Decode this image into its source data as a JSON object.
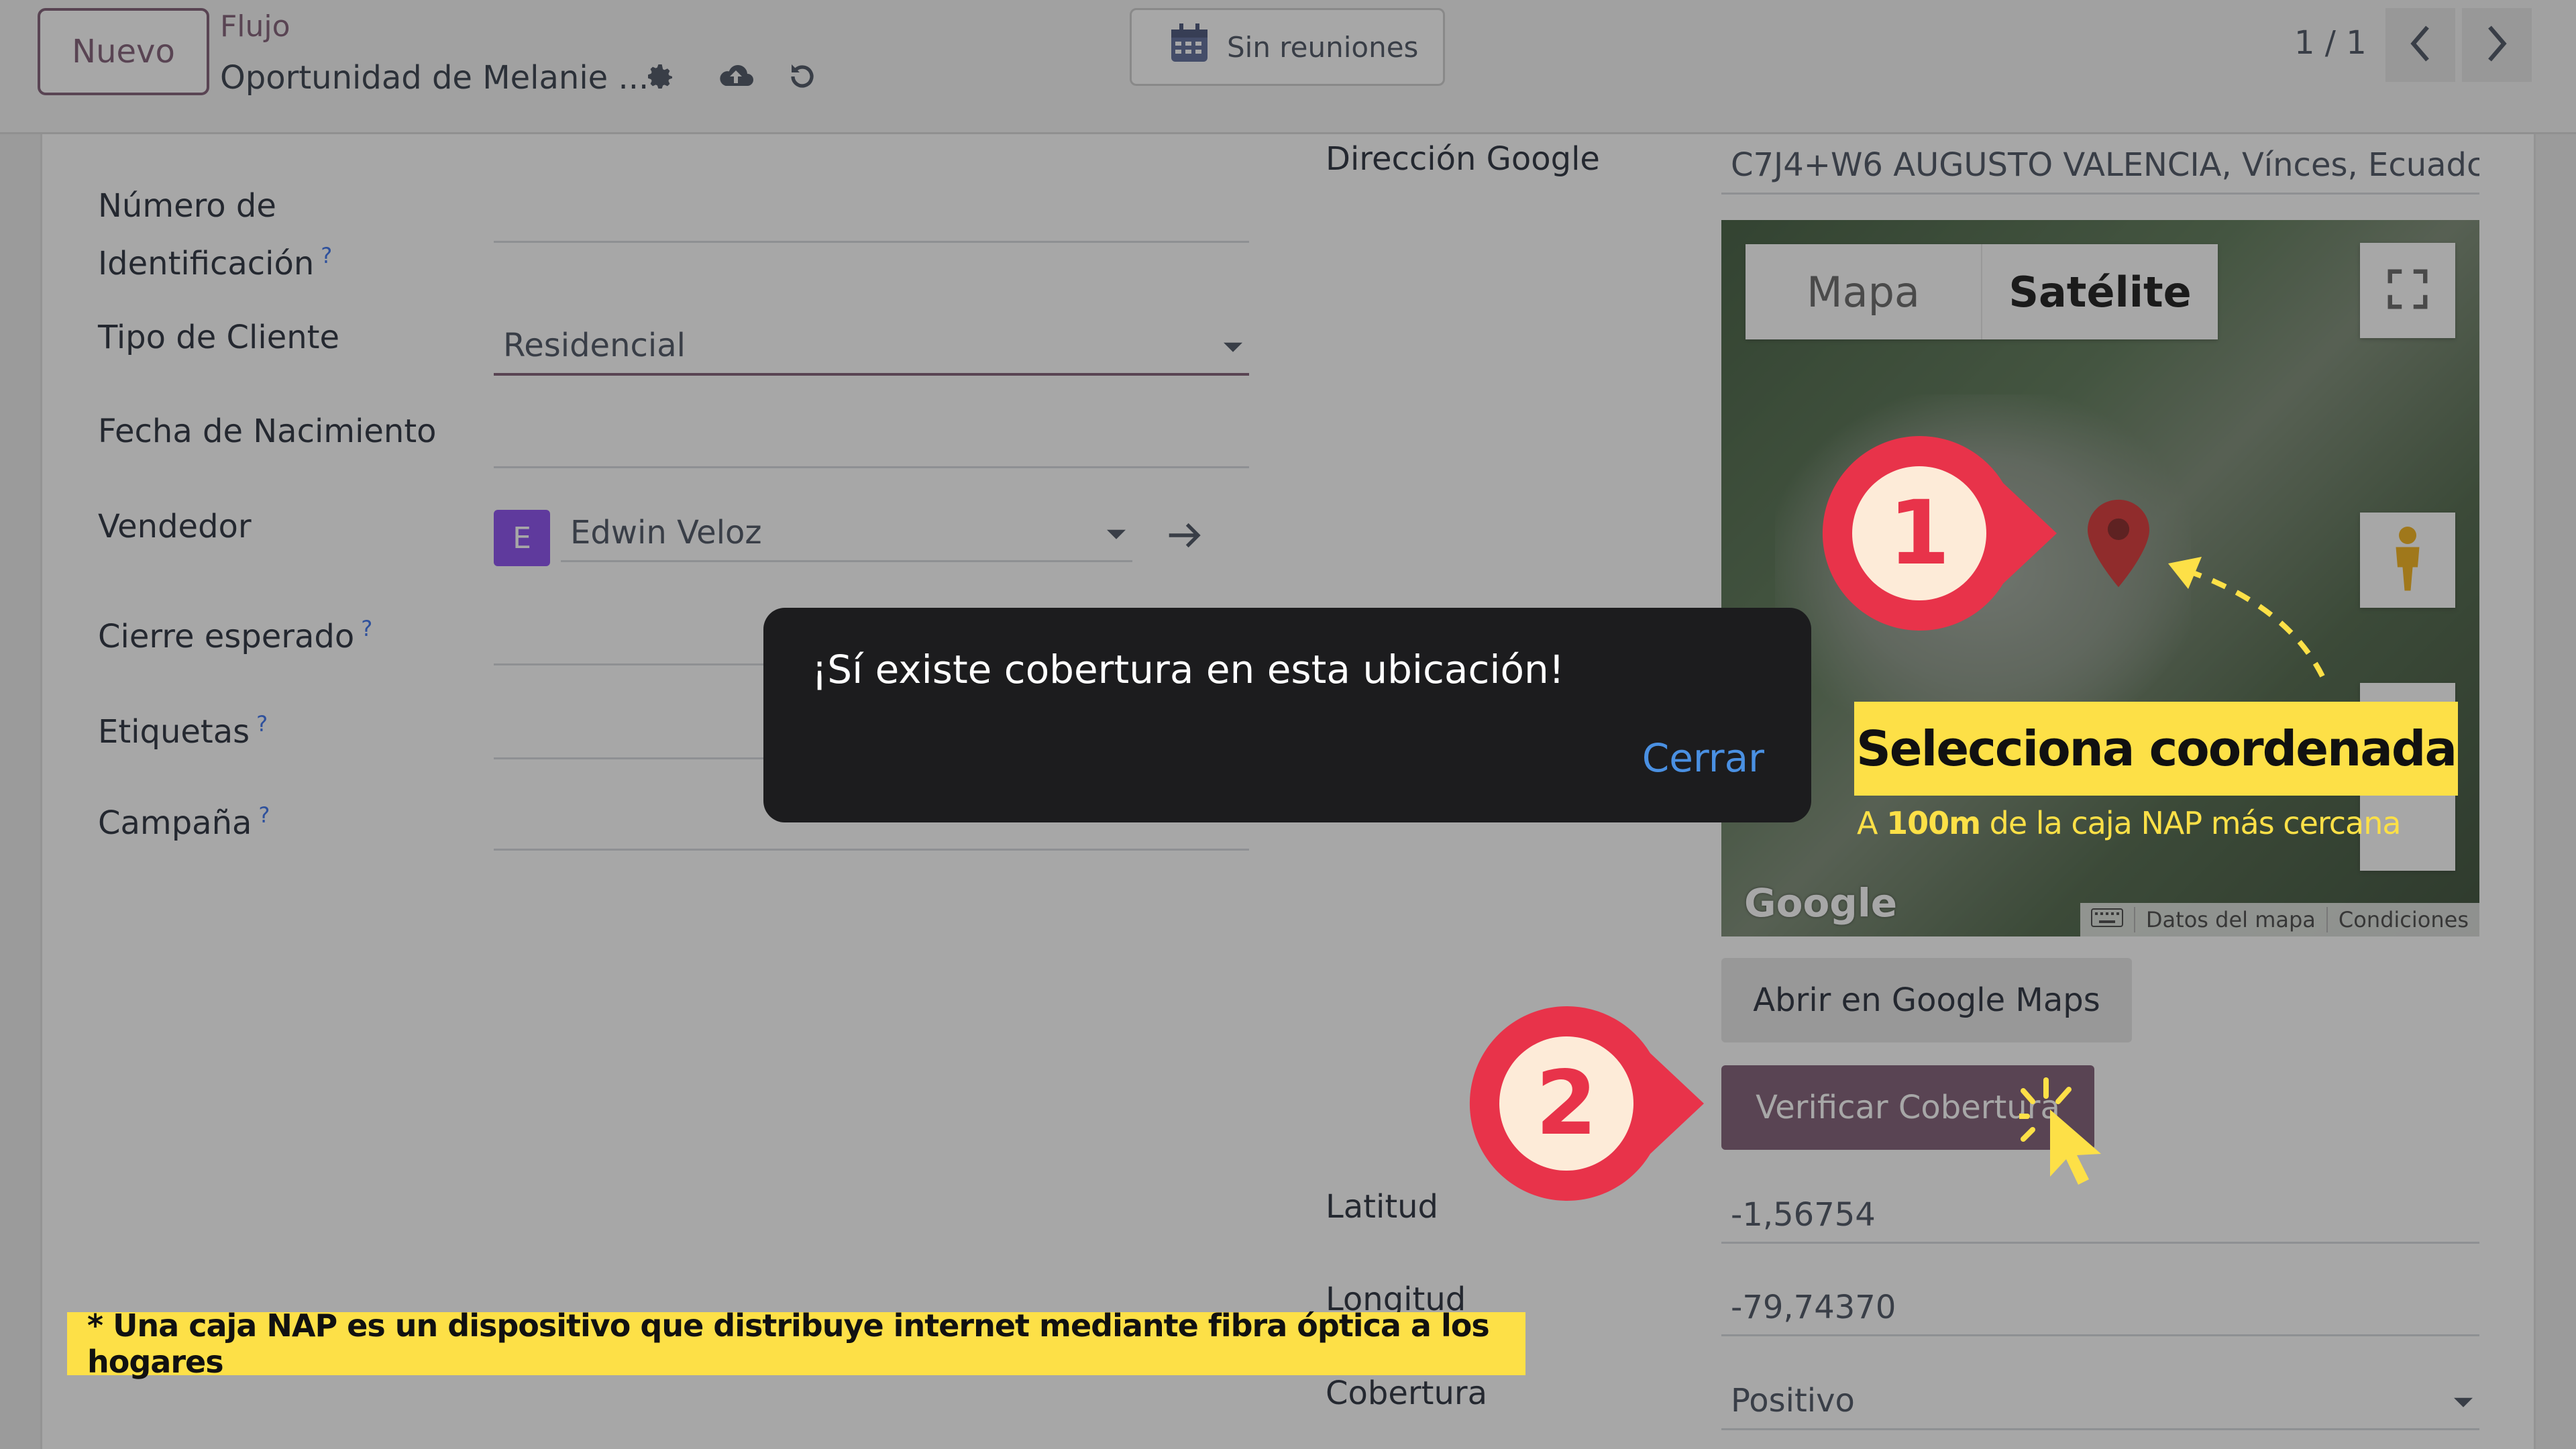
{
  "topbar": {
    "new_button": "Nuevo",
    "breadcrumb_parent": "Flujo",
    "record_title": "Oportunidad de Melanie ...",
    "meetings_button": "Sin reuniones",
    "pager": "1 / 1"
  },
  "form": {
    "id_number_label_line1": "Número de",
    "id_number_label_line2": "Identificación",
    "client_type_label": "Tipo de Cliente",
    "client_type_value": "Residencial",
    "birthdate_label": "Fecha de Nacimiento",
    "seller_label": "Vendedor",
    "seller_initial": "E",
    "seller_value": "Edwin Veloz",
    "expected_close_label": "Cierre esperado",
    "tags_label": "Etiquetas",
    "campaign_label": "Campaña",
    "help_mark": "?",
    "google_address_label": "Dirección Google",
    "google_address_value": "C7J4+W6 AUGUSTO VALENCIA, Vínces, Ecuadc",
    "latitude_label": "Latitud",
    "latitude_value": "-1,56754",
    "longitude_label": "Longitud",
    "longitude_value": "-79,74370",
    "coverage_label": "Cobertura",
    "coverage_value": "Positivo"
  },
  "map": {
    "map_tab": "Mapa",
    "satellite_tab": "Satélite",
    "selected_tab": "Satélite",
    "logo": "Google",
    "attribution_data": "Datos del mapa",
    "attribution_terms": "Condiciones"
  },
  "buttons": {
    "open_gmaps": "Abrir en Google Maps",
    "verify_coverage": "Verificar Cobertura"
  },
  "snackbar": {
    "message": "¡Sí existe cobertura en esta ubicación!",
    "close": "Cerrar"
  },
  "annotations": {
    "step1": "1",
    "step2": "2",
    "callout_title": "Selecciona coordenada",
    "callout_sub_prefix": "A ",
    "callout_sub_bold": "100m",
    "callout_sub_suffix": " de la caja NAP más cercana",
    "footnote": "* Una caja NAP es un dispositivo que distribuye internet mediante fibra óptica a los hogares",
    "accent_color": "#e8334a",
    "highlight_color": "#fde047"
  },
  "icons": [
    "gear-icon",
    "cloud-upload-icon",
    "undo-icon",
    "calendar-icon",
    "chevron-left-icon",
    "chevron-right-icon",
    "arrow-right-icon",
    "fullscreen-icon",
    "pegman-icon",
    "map-pin-icon",
    "keyboard-icon",
    "cursor-icon"
  ]
}
